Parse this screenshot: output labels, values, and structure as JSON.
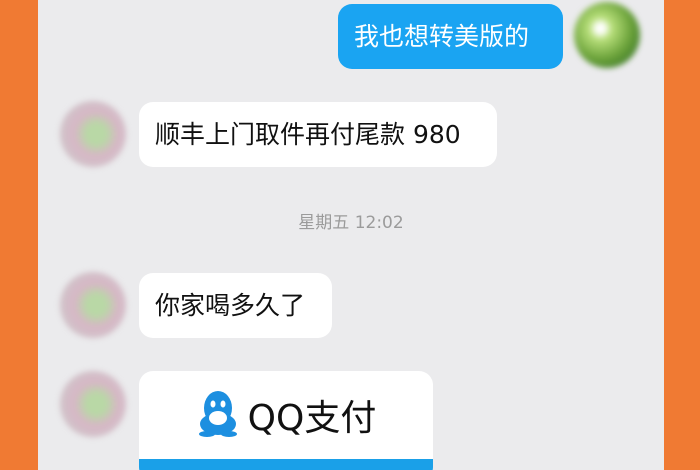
{
  "messages": [
    {
      "side": "out",
      "text": "我也想转美版的"
    },
    {
      "side": "in",
      "text": "顺丰上门取件再付尾款 980"
    },
    {
      "side": "in",
      "text": "你家喝多久了"
    }
  ],
  "timestamp": "星期五 12:02",
  "pay_card": {
    "title": "QQ支付",
    "icon": "qq-penguin-icon"
  }
}
